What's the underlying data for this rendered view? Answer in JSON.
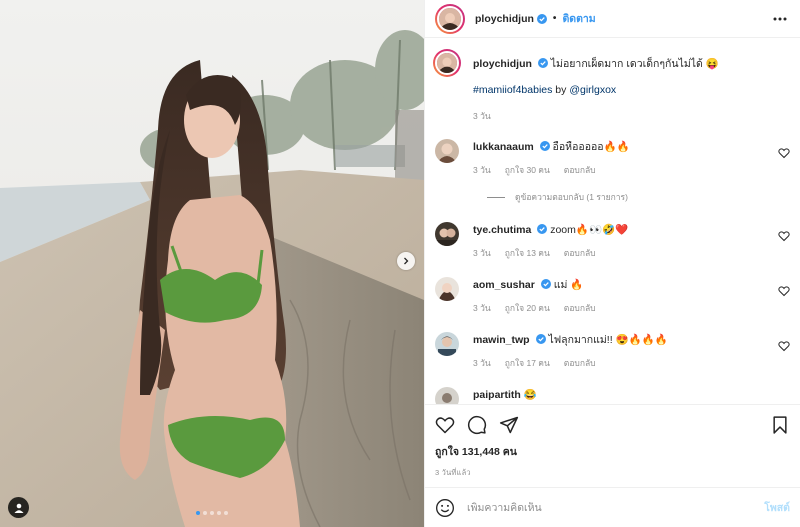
{
  "post": {
    "username": "ploychidjun",
    "follow_label": "ติดตาม",
    "separator": "•",
    "caption_text": "ไม่อยากเผ็ดมาก เดวเด็กๆกันไม่ได้ 😝",
    "caption_hashtag": "#mamiiof4babies",
    "caption_by": " by ",
    "caption_mention": "@girlgxox",
    "caption_time": "3 วัน",
    "likes": "ถูกใจ 131,448 คน",
    "posted_ago": "3 วันที่แล้ว",
    "image_count": 5,
    "active_image_index": 0
  },
  "comments": [
    {
      "username": "lukkanaaum",
      "verified": true,
      "text": "อือหือออออ🔥🔥",
      "time": "3 วัน",
      "likes": "ถูกใจ 30 คน",
      "reply": "ตอบกลับ"
    },
    {
      "username": "tye.chutima",
      "verified": true,
      "text": "zoom🔥👀🤣❤️",
      "time": "3 วัน",
      "likes": "ถูกใจ 13 คน",
      "reply": "ตอบกลับ"
    },
    {
      "username": "aom_sushar",
      "verified": true,
      "text": "แม่ 🔥",
      "time": "3 วัน",
      "likes": "ถูกใจ 20 คน",
      "reply": "ตอบกลับ"
    },
    {
      "username": "mawin_twp",
      "verified": true,
      "text": "ไฟลุกมากแม่!! 😍🔥🔥🔥",
      "time": "3 วัน",
      "likes": "ถูกใจ 17 คน",
      "reply": "ตอบกลับ"
    },
    {
      "username": "paipartith",
      "verified": false,
      "text": "😂",
      "time": "",
      "likes": "",
      "reply": ""
    }
  ],
  "view_replies": "ดูข้อความตอบกลับ (1 รายการ)",
  "add_comment": {
    "placeholder": "เพิ่มความคิดเห็น",
    "post_label": "โพสต์"
  },
  "colors": {
    "link": "#3897f0",
    "hashtag": "#003569",
    "muted": "#8e8e8e",
    "post_disabled": "#b2dffc",
    "divider": "#efefef"
  },
  "icons": {
    "verified": "verified-badge-icon",
    "more": "more-options-icon",
    "heart": "heart-icon",
    "comment": "comment-icon",
    "share": "share-icon",
    "bookmark": "bookmark-icon",
    "emoji": "emoji-icon",
    "next": "chevron-right-icon",
    "user_tag": "user-tag-icon"
  }
}
